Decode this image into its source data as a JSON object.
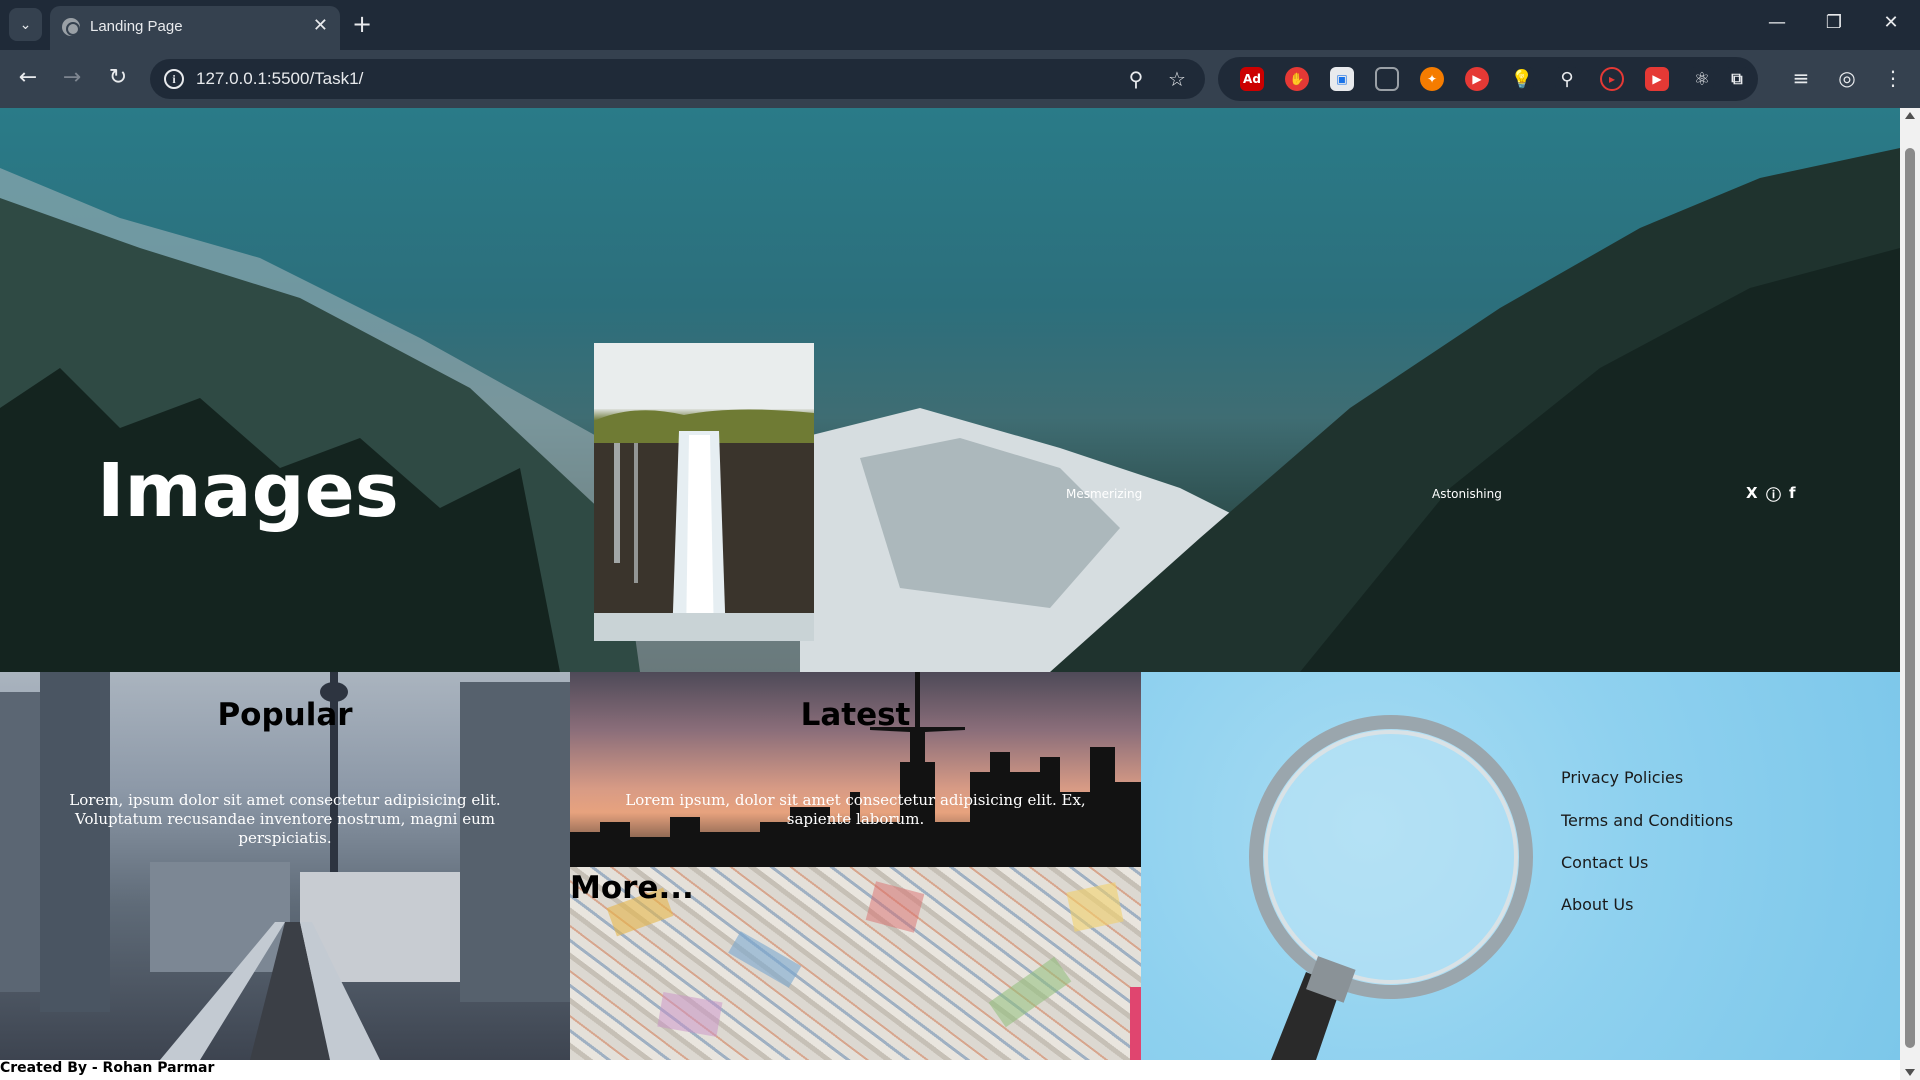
{
  "browser": {
    "tab_title": "Landing Page",
    "url": "127.0.0.1:5500/Task1/",
    "new_tab_symbol": "+",
    "tab_close_symbol": "✕"
  },
  "hero": {
    "title": "Images",
    "links": [
      "Mesmerizing",
      "Astonishing"
    ],
    "social": [
      "X",
      "ⓘ",
      "f"
    ]
  },
  "cards": {
    "popular": {
      "title": "Popular",
      "text": "Lorem, ipsum dolor sit amet consectetur adipisicing elit. Voluptatum recusandae inventore nostrum, magni eum perspiciatis."
    },
    "latest": {
      "title": "Latest",
      "text": "Lorem ipsum, dolor sit amet consectetur adipisicing elit. Ex, sapiente laborum."
    },
    "more": {
      "title": "More..."
    }
  },
  "footer": {
    "links": [
      "Privacy Policies",
      "Terms and Conditions",
      "Contact Us",
      "About Us"
    ]
  },
  "credit": "Created By - Rohan Parmar",
  "colors": {
    "chrome_dark": "#1f2a38",
    "chrome_mid": "#35414f",
    "hero_teal": "#2a7b88",
    "footer_blue": "#8fd1ef"
  }
}
